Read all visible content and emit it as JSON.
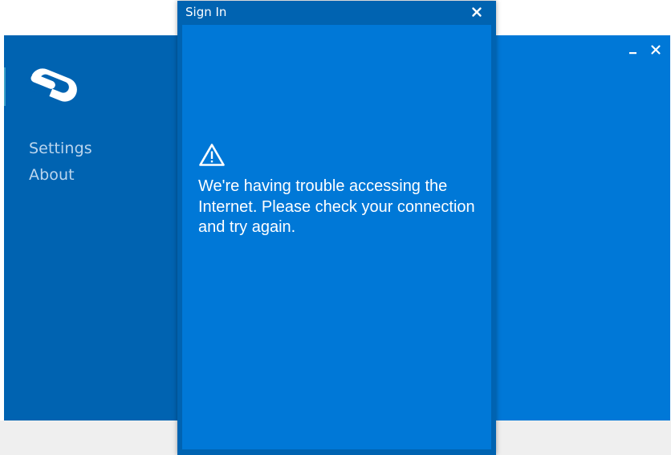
{
  "app": {
    "nav": {
      "settings_label": "Settings",
      "about_label": "About"
    },
    "logo_icon": "app-logo",
    "controls": [
      "minimize-icon",
      "close-icon"
    ]
  },
  "dialog": {
    "title": "Sign In",
    "close_icon": "close-icon",
    "warning_icon": "warning-icon",
    "message": "We're having trouble accessing the Internet. Please check your connection and try again."
  },
  "colors": {
    "accent": "#0078d7",
    "sidebar": "#0063b1",
    "text": "#ffffff",
    "nav_text": "#bcd6ee"
  }
}
